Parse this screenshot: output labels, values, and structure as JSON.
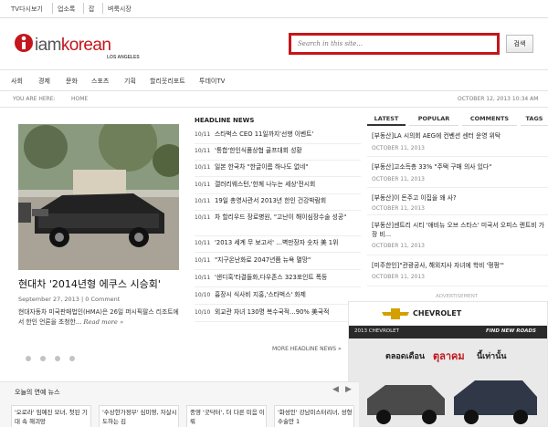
{
  "topbar": [
    "TV다시보기",
    "업소록",
    "잡",
    "벼룩시장"
  ],
  "search": {
    "placeholder": "Search in this site...",
    "button": "검색"
  },
  "logo": {
    "main": "iamkorean",
    "sub": "LOS ANGELES"
  },
  "nav": [
    "사회",
    "경제",
    "문화",
    "스포츠",
    "기획",
    "할리웃리포트",
    "투데이TV"
  ],
  "breadcrumb": {
    "label": "YOU ARE HERE:",
    "home": "HOME",
    "date": "OCTOBER 12, 2013 10:34 AM"
  },
  "featured": {
    "title": "현대차 '2014년형 에쿠스 시승회'",
    "date": "September 27, 2013",
    "comments": "0 Comment",
    "excerpt": "현대자동차 미국판매법인(HMA)은 26일 퍼시픽팔스 리조트에서 한인 언론을 초청한...",
    "read_more": "Read more »"
  },
  "headlines": {
    "title": "HEADLINE NEWS",
    "items": [
      {
        "date": "10/11",
        "text": "스타벅스 CEO 11일까지'선행 이벤트'"
      },
      {
        "date": "10/11",
        "text": "'통합'한인식품상협 골프대회 성황"
      },
      {
        "date": "10/11",
        "text": "일본 한국차 \"한글이름 하나도 없네\""
      },
      {
        "date": "10/11",
        "text": "갤러리웨스턴,'한께 나누는 세상'전시회"
      },
      {
        "date": "10/11",
        "text": "19일 총영사관서 2013년 한인 건강박람회"
      },
      {
        "date": "10/11",
        "text": "차 할리우드 장로병원, \"고난이 해이심장수술 성공\""
      },
      {
        "date": "10/11",
        "text": "'2013 세계 무 보고서' …벽만장자 숫자 美 1위"
      },
      {
        "date": "10/11",
        "text": "\"지구온난화로 2047년쯤 뉴욕 멸망\""
      },
      {
        "date": "10/11",
        "text": "'샌디훅'타결들화,다우존스 323포인트 폭등"
      },
      {
        "date": "10/10",
        "text": "흉장시 식사비 지홍,'스타벅스' 화제"
      },
      {
        "date": "10/10",
        "text": "외교관 자녀 130명 복수국적…90% 美국적"
      }
    ],
    "more": "MORE HEADLINE NEWS »"
  },
  "tabs": [
    "LATEST",
    "POPULAR",
    "COMMENTS",
    "TAGS"
  ],
  "latest": [
    {
      "title": "[부동산]LA 시의회 AEG에 컨벤션 센터 운영 위탁",
      "date": "OCTOBER 11, 2013"
    },
    {
      "title": "[부동산]고소득층 33% \"주택 구매 의사 있다\"",
      "date": "OCTOBER 11, 2013"
    },
    {
      "title": "[부동산]이 돈주고 이집을 왜 사?",
      "date": "OCTOBER 11, 2013"
    },
    {
      "title": "[부동산]센트리 시티 '애비뉴 오브 스타스' 미국서 오피스 렌트비 가장 비...",
      "date": "OCTOBER 11, 2013"
    },
    {
      "title": "[미주한인]\"관광공사, 해외지사 자녀에 학비 '펑펑'\"",
      "date": "OCTOBER 11, 2013"
    }
  ],
  "ad": {
    "label": "ADVERTISEMENT",
    "brand": "CHEVROLET",
    "model": "2013 CHEVROLET",
    "slogan_find": "FIND NEW ROADS",
    "thai_1": "ตลอดเดือน",
    "thai_2": "ตุลาคม",
    "thai_3": "นี้เท่านั้น"
  },
  "bottom": {
    "title": "오늘의 연예 뉴스",
    "cards": [
      "'오로라' 임예진 모녀, 첫된 기대 속 해괴망",
      "'수상한가정부' 심미영, 자살시도하는 김",
      "종영 '굿닥터', 더 다른 미음 이뤄",
      "'화성인' 강남미스터리녀, 성형수술만 1"
    ]
  },
  "colors": {
    "brand_red": "#c4161c",
    "accent_gray": "#333333"
  }
}
